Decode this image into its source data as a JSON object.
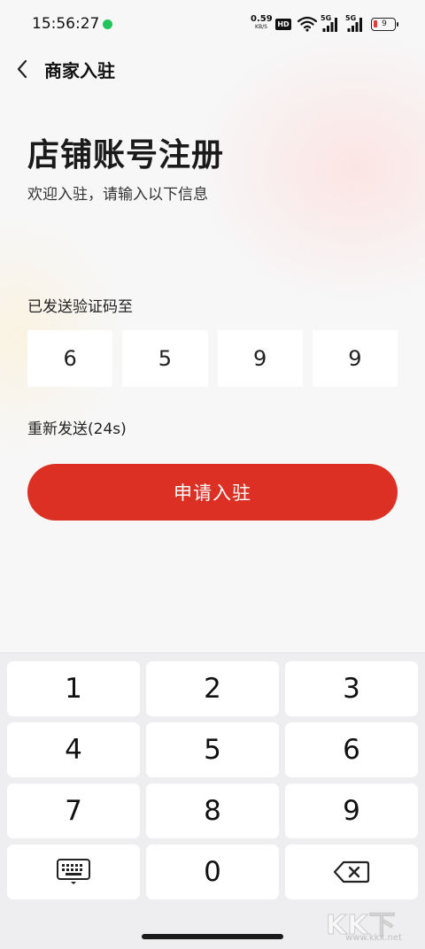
{
  "status_bar": {
    "time": "15:56:27",
    "speed_value": "0.59",
    "speed_unit": "KB/S",
    "hd_label": "HD",
    "net_label_1": "5G",
    "net_label_2": "5G",
    "battery_level": "9"
  },
  "header": {
    "title": "商家入驻"
  },
  "main": {
    "title": "店铺账号注册",
    "subtitle": "欢迎入驻，请输入以下信息",
    "code_label": "已发送验证码至",
    "code_digits": [
      "6",
      "5",
      "9",
      "9"
    ],
    "resend_label": "重新发送(24s)",
    "submit_label": "申请入驻"
  },
  "keypad": {
    "keys": [
      "1",
      "2",
      "3",
      "4",
      "5",
      "6",
      "7",
      "8",
      "9",
      "0"
    ]
  },
  "watermark": {
    "main": "KK下载",
    "sub": "www.kkx.net"
  },
  "colors": {
    "accent": "#dd3025",
    "background": "#f7f7f8",
    "keypad_bg": "#eeeef0"
  }
}
